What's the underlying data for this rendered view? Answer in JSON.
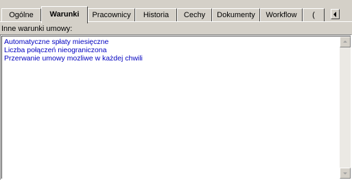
{
  "tabs": [
    {
      "label": "Ogólne",
      "active": false
    },
    {
      "label": "Warunki",
      "active": true
    },
    {
      "label": "Pracownicy",
      "active": false
    },
    {
      "label": "Historia",
      "active": false
    },
    {
      "label": "Cechy",
      "active": false
    },
    {
      "label": "Dokumenty",
      "active": false
    },
    {
      "label": "Workflow",
      "active": false
    },
    {
      "label": "(",
      "active": false
    }
  ],
  "field": {
    "label": "Inne warunki umowy:",
    "lines": [
      "Automatyczne spłaty miesięczne",
      "Liczba połączeń nieograniczona",
      "Przerwanie umowy mozliwe w każdej chwili"
    ]
  },
  "colors": {
    "background": "#d4d0c8",
    "memo_text": "#0000c0"
  },
  "icons": {
    "tab_scroll": "chevron-left-icon",
    "scroll_up": "scroll-up-icon",
    "scroll_down": "scroll-down-icon"
  }
}
